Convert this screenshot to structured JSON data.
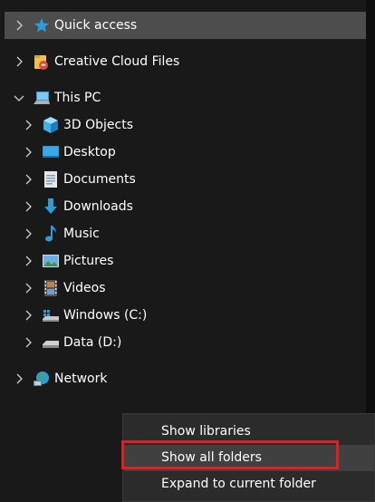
{
  "nav": {
    "quick_access": "Quick access",
    "creative_cloud": "Creative Cloud Files",
    "this_pc": "This PC",
    "children": {
      "objects3d": "3D Objects",
      "desktop": "Desktop",
      "documents": "Documents",
      "downloads": "Downloads",
      "music": "Music",
      "pictures": "Pictures",
      "videos": "Videos",
      "windows_c": "Windows (C:)",
      "data_d": "Data (D:)"
    },
    "network": "Network"
  },
  "context_menu": {
    "show_libraries": "Show libraries",
    "show_all_folders": "Show all folders",
    "expand_current": "Expand to current folder"
  },
  "colors": {
    "background": "#191919",
    "selected_row": "#4d4d4d",
    "menu_background": "#2b2b2b",
    "highlight_box": "#e02020",
    "folder_blue": "#2d9cdb"
  },
  "icons": {
    "quick_access": "star-icon",
    "creative_cloud": "creative-cloud-folder-icon",
    "this_pc": "computer-icon",
    "objects3d": "cube-icon",
    "desktop": "desktop-icon",
    "documents": "documents-icon",
    "downloads": "download-arrow-icon",
    "music": "music-note-icon",
    "pictures": "pictures-icon",
    "videos": "film-icon",
    "windows_c": "system-drive-icon",
    "data_d": "drive-icon",
    "network": "network-globe-icon"
  }
}
